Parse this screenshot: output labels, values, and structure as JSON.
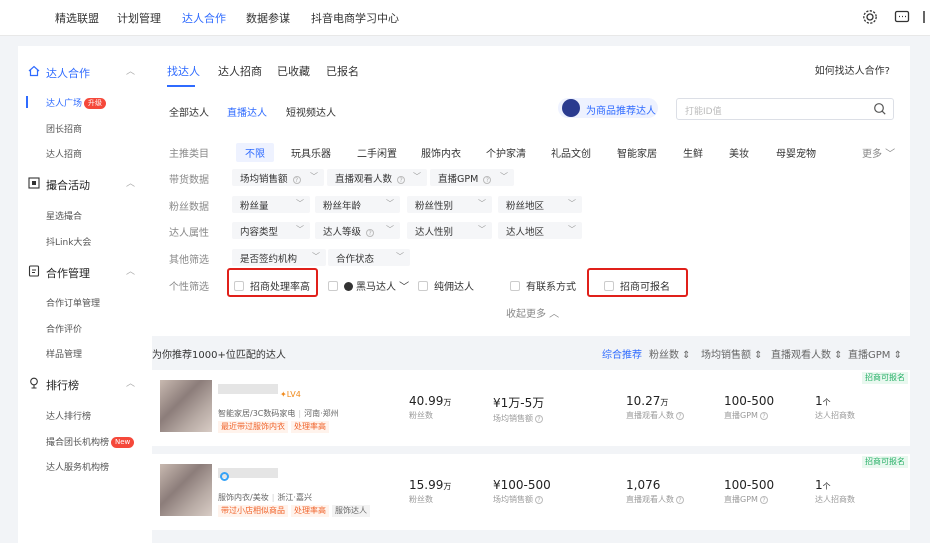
{
  "topnav": {
    "items": [
      "精选联盟",
      "计划管理",
      "达人合作",
      "数据参谋",
      "抖音电商学习中心"
    ],
    "active_index": 2
  },
  "sidebar": {
    "groups": [
      {
        "label": "达人合作",
        "items": [
          {
            "label": "达人广场",
            "badge": "升级",
            "active": true
          },
          {
            "label": "团长招商"
          },
          {
            "label": "达人招商"
          }
        ]
      },
      {
        "label": "撮合活动",
        "items": [
          {
            "label": "星选撮合"
          },
          {
            "label": "抖Link大会"
          }
        ]
      },
      {
        "label": "合作管理",
        "items": [
          {
            "label": "合作订单管理"
          },
          {
            "label": "合作评价"
          },
          {
            "label": "样品管理"
          }
        ]
      },
      {
        "label": "排行榜",
        "items": [
          {
            "label": "达人排行榜"
          },
          {
            "label": "撮合团长机构榜",
            "badge": "New"
          },
          {
            "label": "达人服务机构榜"
          }
        ]
      }
    ]
  },
  "main": {
    "tabs": [
      "找达人",
      "达人招商",
      "已收藏",
      "已报名"
    ],
    "help": "如何找达人合作?",
    "subtabs": [
      "全部达人",
      "直播达人",
      "短视频达人"
    ],
    "recommend": "为商品推荐达人",
    "search_placeholder": "打能ID值",
    "filters": {
      "category_label": "主推类目",
      "categories": [
        "不限",
        "玩具乐器",
        "二手闲置",
        "服饰内衣",
        "个护家清",
        "礼品文创",
        "智能家居",
        "生鲜",
        "美妆",
        "母婴宠物"
      ],
      "more": "更多",
      "sales_label": "带货数据",
      "sales": [
        "场均销售额",
        "直播观看人数",
        "直播GPM"
      ],
      "fans_label": "粉丝数据",
      "fans": [
        "粉丝量",
        "粉丝年龄",
        "粉丝性别",
        "粉丝地区"
      ],
      "attr_label": "达人属性",
      "attrs": [
        "内容类型",
        "达人等级",
        "达人性别",
        "达人地区"
      ],
      "other_label": "其他筛选",
      "others": [
        "是否签约机构",
        "合作状态"
      ],
      "personal_label": "个性筛选",
      "personal": [
        "招商处理率高",
        "黑马达人",
        "纯佣达人",
        "有联系方式",
        "招商可报名"
      ],
      "collapse": "收起更多"
    }
  },
  "list": {
    "title": "为你推荐1000+位匹配的达人",
    "sorts": [
      "综合推荐",
      "粉丝数",
      "场均销售额",
      "直播观看人数",
      "直播GPM"
    ],
    "cards": [
      {
        "level": "LV4",
        "meta": [
          "智能家居/3C数码家电",
          "河南·郑州"
        ],
        "tags": [
          "最近带过服饰内衣",
          "处理率高"
        ],
        "fans": "40.99",
        "fans_unit": "万",
        "fans_label": "粉丝数",
        "sales": "¥1万-5万",
        "sales_label": "场均销售额",
        "viewers": "10.27",
        "viewers_unit": "万",
        "viewers_label": "直播观看人数",
        "gpm": "100-500",
        "gpm_label": "直播GPM",
        "recruit": "1",
        "recruit_unit": "个",
        "recruit_label": "达人招商数",
        "corner": "招商可报名"
      },
      {
        "meta": [
          "服饰内衣/美妆",
          "浙江·嘉兴"
        ],
        "tags": [
          "带过小店相似商品",
          "处理率高",
          "服饰达人"
        ],
        "fans": "15.99",
        "fans_unit": "万",
        "fans_label": "粉丝数",
        "sales": "¥100-500",
        "sales_label": "场均销售额",
        "viewers": "1,076",
        "viewers_label": "直播观看人数",
        "gpm": "100-500",
        "gpm_label": "直播GPM",
        "recruit": "1",
        "recruit_unit": "个",
        "recruit_label": "达人招商数",
        "corner": "招商可报名"
      }
    ]
  },
  "colors": {
    "accent": "#2f6bff",
    "highlight_box": "#e0201a",
    "tag_orange": "#f0632a",
    "corner_green": "#27b067"
  }
}
